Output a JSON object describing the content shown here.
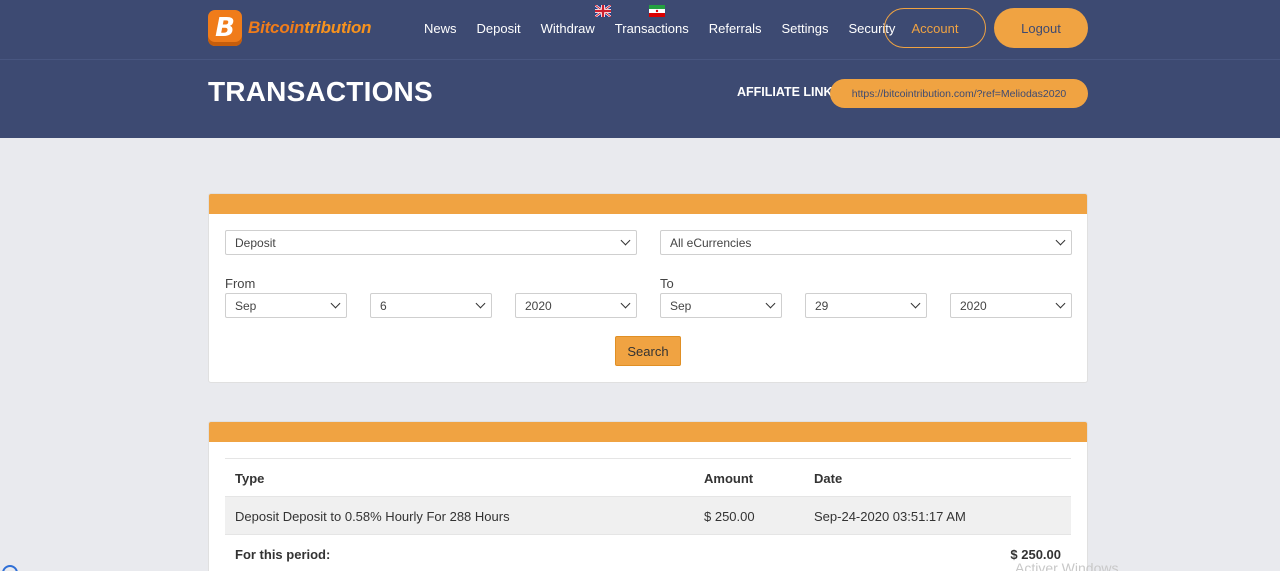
{
  "header": {
    "brand_part1": "Bitcoin",
    "brand_part2": "tribution",
    "logo_letter": "B",
    "nav": [
      "News",
      "Deposit",
      "Withdraw",
      "Transactions",
      "Referrals",
      "Settings",
      "Security"
    ],
    "languages": [
      "english-flag",
      "iran-flag"
    ],
    "account_label": "Account",
    "logout_label": "Logout",
    "page_title": "TRANSACTIONS",
    "affiliate_label": "AFFILIATE LINK:",
    "affiliate_url": "https://bitcointribution.com/?ref=Meliodas2020"
  },
  "filter": {
    "type_value": "Deposit",
    "currency_value": "All eCurrencies",
    "from_label": "From",
    "to_label": "To",
    "from_month": "Sep",
    "from_day": "6",
    "from_year": "2020",
    "to_month": "Sep",
    "to_day": "29",
    "to_year": "2020",
    "search_label": "Search"
  },
  "table": {
    "headers": [
      "Type",
      "Amount",
      "Date"
    ],
    "rows": [
      {
        "type": "Deposit Deposit to 0.58% Hourly For 288 Hours",
        "amount": "$ 250.00",
        "date": "Sep-24-2020 03:51:17 AM"
      }
    ],
    "period_label": "For this period:",
    "period_total": "$ 250.00"
  },
  "system": {
    "watermark": "Activer Windows"
  },
  "colors": {
    "navy": "#3d4a72",
    "accent": "#f0a342",
    "logo": "#f07c1a"
  }
}
